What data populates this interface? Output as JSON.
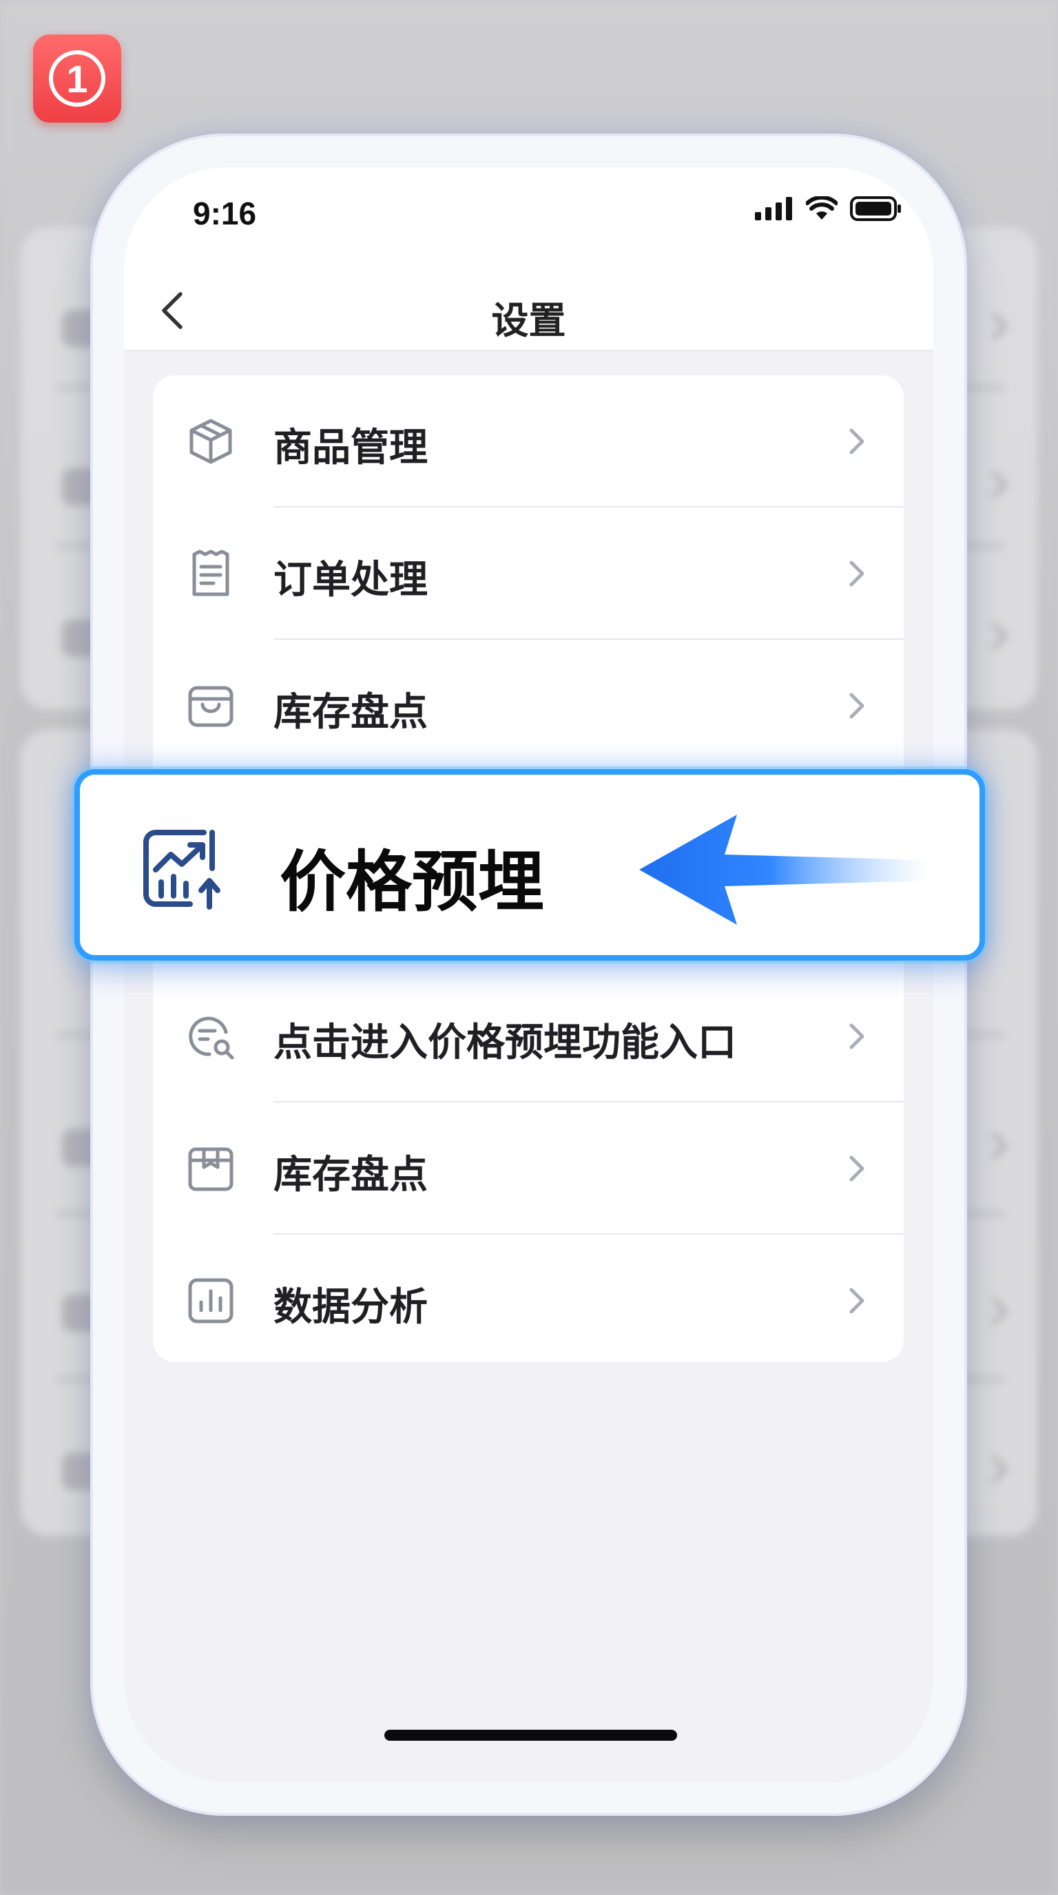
{
  "step_badge": "①",
  "status_bar": {
    "time": "9:16",
    "icons": [
      "signal-icon",
      "wifi-icon",
      "battery-icon"
    ]
  },
  "nav": {
    "back_icon": "chevron-left-icon",
    "title": "设置"
  },
  "menu": {
    "items": [
      {
        "label": "商品管理",
        "icon": "package-icon"
      },
      {
        "label": "订单处理",
        "icon": "receipt-icon"
      },
      {
        "label": "库存盘点",
        "icon": "basket-icon"
      },
      {
        "label": "点击进入价格预埋功能入口",
        "icon": "search-chat-icon"
      },
      {
        "label": "库存盘点",
        "icon": "box-icon"
      },
      {
        "label": "数据分析",
        "icon": "bar-chart-icon"
      }
    ]
  },
  "highlight": {
    "label": "价格预埋",
    "icon": "trend-chart-icon",
    "pointer_icon": "arrow-left-icon"
  },
  "colors": {
    "accent": "#2f9cff",
    "badge": "#ef3f45",
    "icon_gray": "#8a8e99",
    "icon_blue": "#2a4c8a"
  }
}
